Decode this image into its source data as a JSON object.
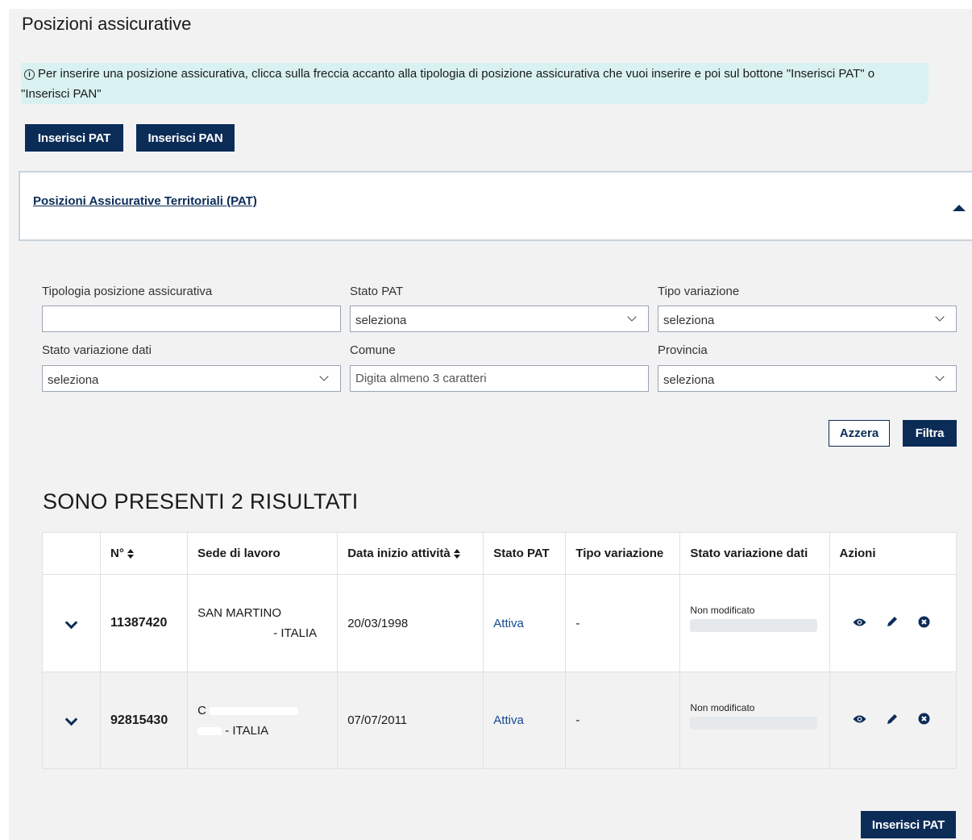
{
  "page": {
    "title": "Posizioni assicurative"
  },
  "info": {
    "text": "Per inserire una posizione assicurativa, clicca sulla freccia accanto alla tipologia di posizione assicurativa che vuoi inserire e poi sul bottone \"Inserisci PAT\" o \"Inserisci PAN\""
  },
  "top_buttons": {
    "pat": "Inserisci PAT",
    "pan": "Inserisci PAN"
  },
  "accordion": {
    "title": "Posizioni Assicurative Territoriali (PAT)",
    "expanded": true
  },
  "filters": {
    "tipologia": {
      "label": "Tipologia posizione assicurativa",
      "value": ""
    },
    "stato_pat": {
      "label": "Stato PAT",
      "value": "seleziona"
    },
    "tipo_variazione": {
      "label": "Tipo variazione",
      "value": "seleziona"
    },
    "stato_variazione": {
      "label": "Stato variazione dati",
      "value": "seleziona"
    },
    "comune": {
      "label": "Comune",
      "placeholder": "Digita almeno 3 caratteri"
    },
    "provincia": {
      "label": "Provincia",
      "value": "seleziona"
    },
    "reset": "Azzera",
    "apply": "Filtra"
  },
  "results": {
    "heading": "SONO PRESENTI 2 RISULTATI",
    "columns": [
      "N°",
      "Sede di lavoro",
      "Data inizio attività",
      "Stato PAT",
      "Tipo variazione",
      "Stato variazione dati",
      "Azioni"
    ],
    "rows": [
      {
        "numero": "11387420",
        "sede_line1": "SAN MARTINO",
        "sede_line2": "- ITALIA",
        "data": "20/03/1998",
        "stato": "Attiva",
        "tipo": "-",
        "stato_var": "Non modificato"
      },
      {
        "numero": "92815430",
        "sede_line1": "C",
        "sede_line2": "- ITALIA",
        "data": "07/07/2011",
        "stato": "Attiva",
        "tipo": "-",
        "stato_var": "Non modificato"
      }
    ]
  },
  "bottom_button": "Inserisci PAT",
  "colors": {
    "primary": "#0c2c58",
    "info_bg": "#d9f1f1",
    "link": "#17498e",
    "panel_bg": "#f2f2f2"
  }
}
